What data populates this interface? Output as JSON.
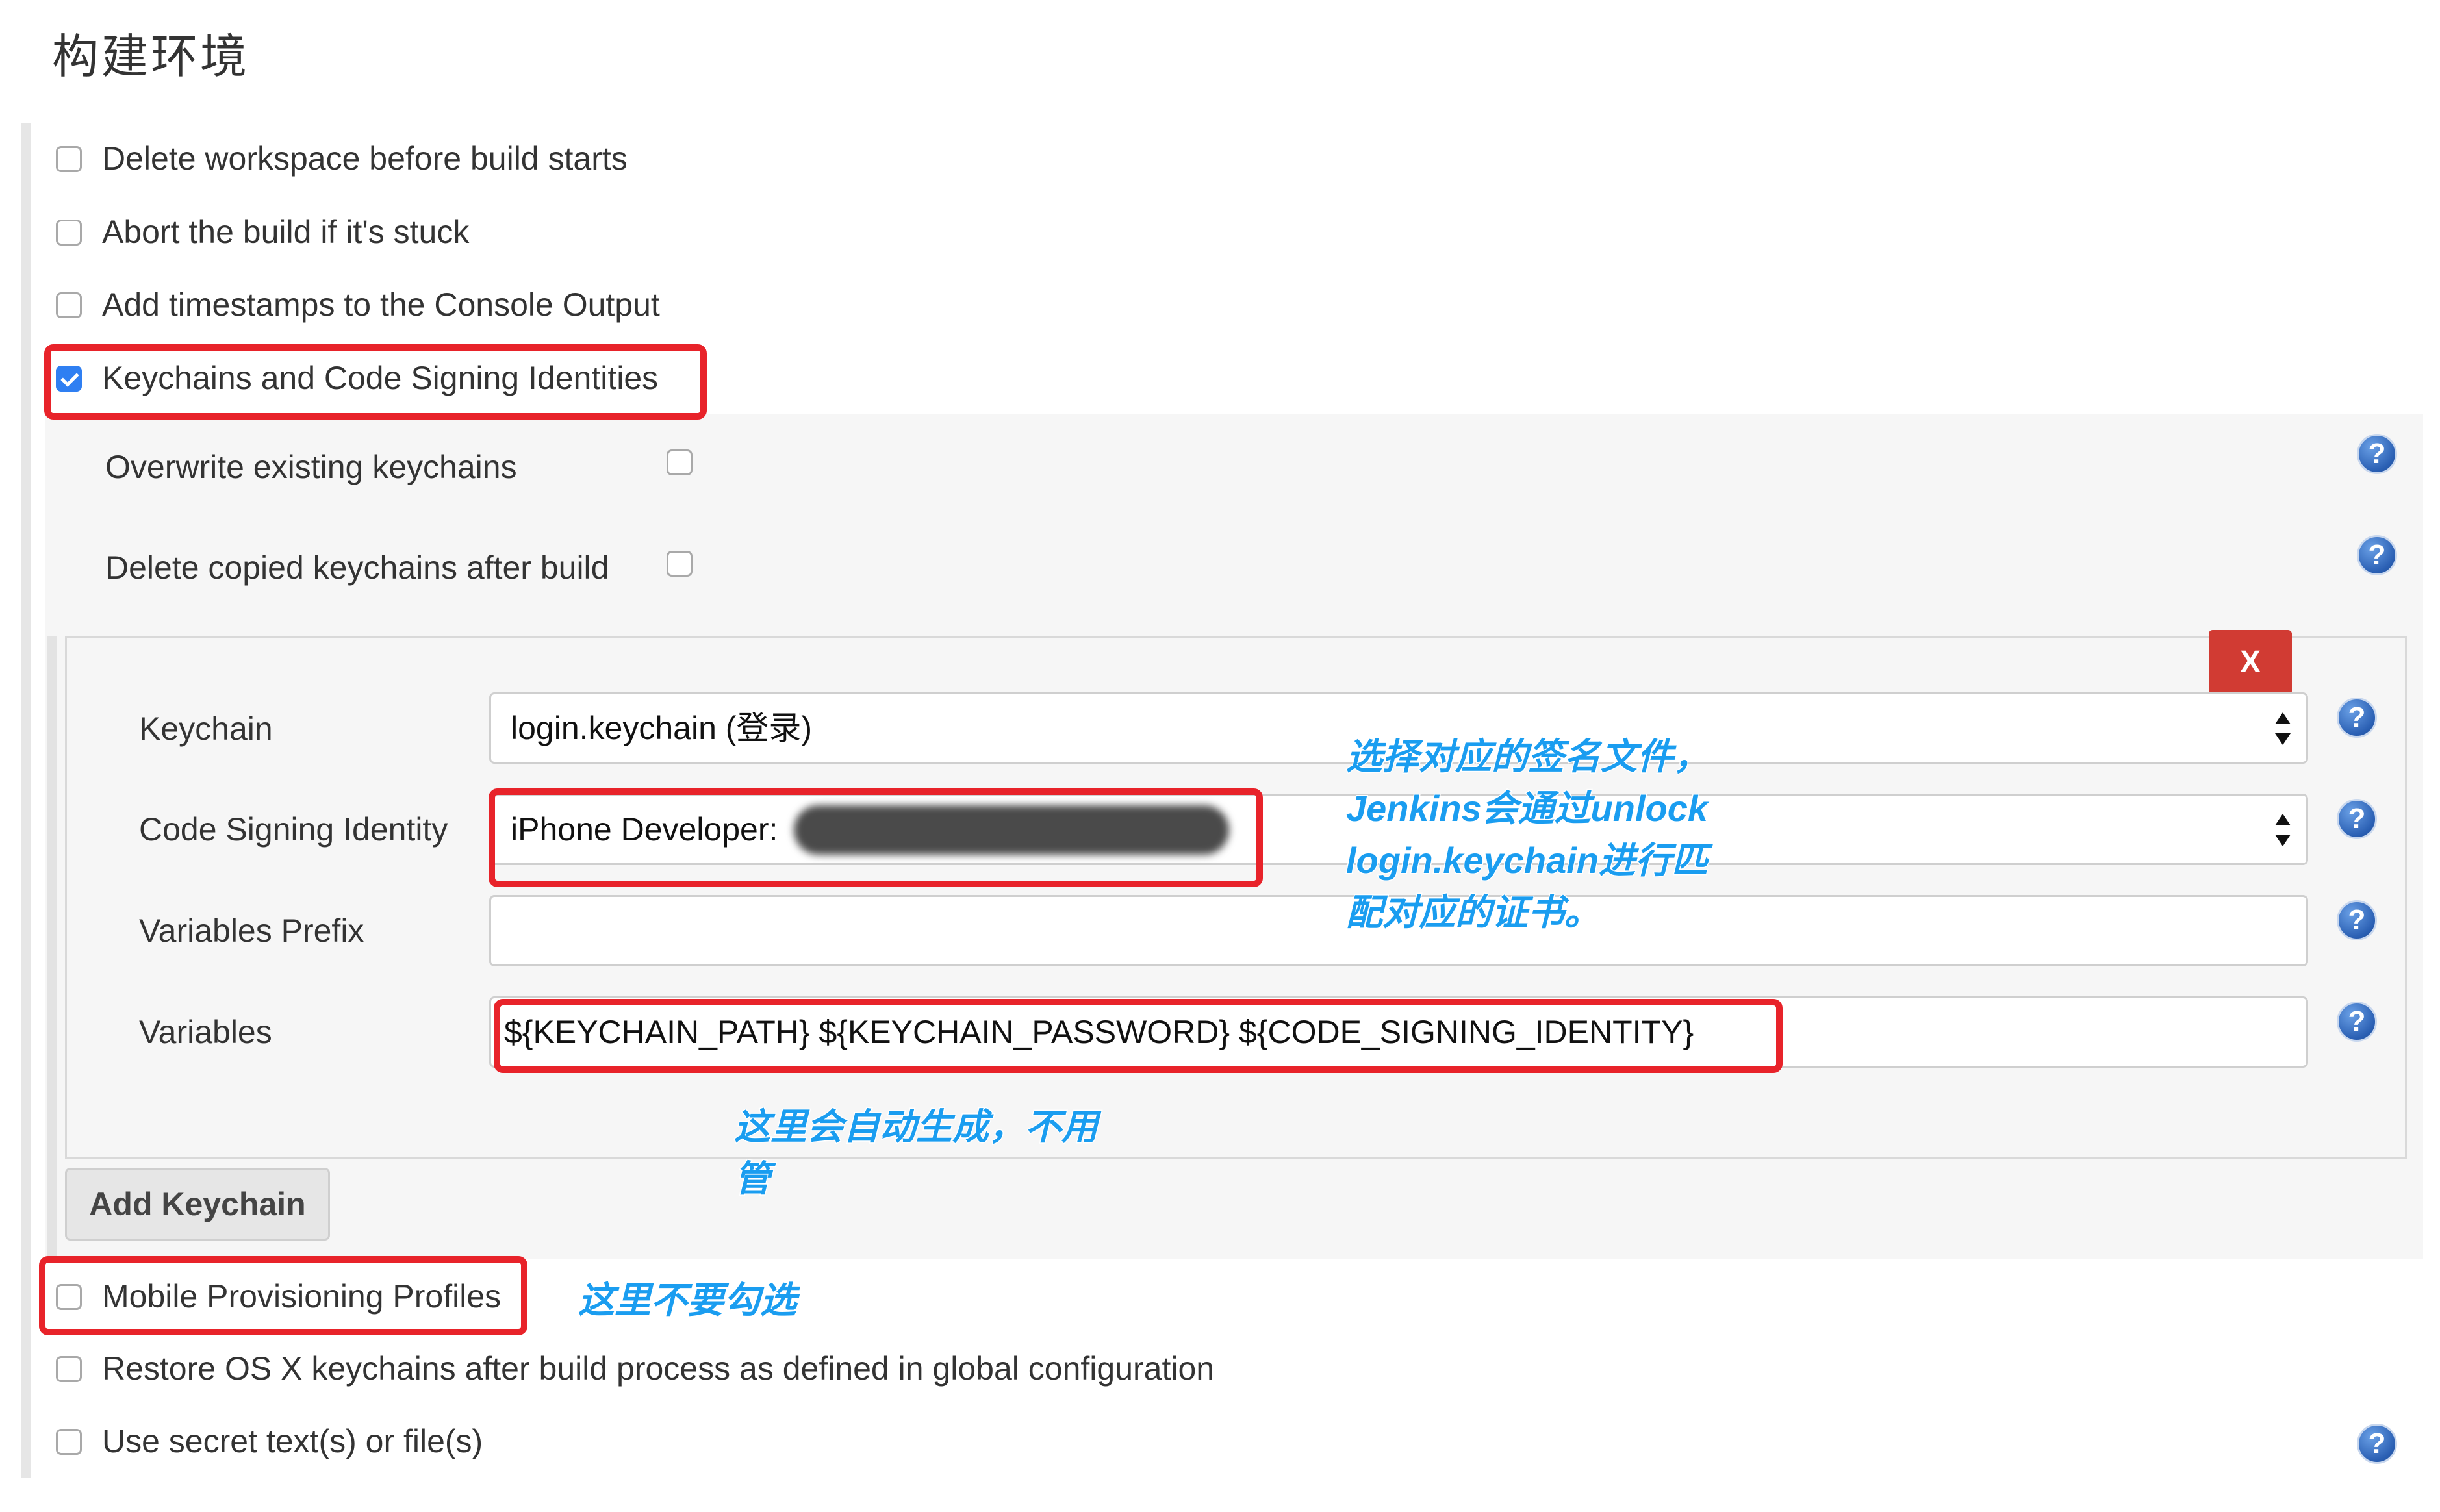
{
  "section_title": "构建环境",
  "options": [
    {
      "label": "Delete workspace before build starts",
      "checked": false
    },
    {
      "label": "Abort the build if it's stuck",
      "checked": false
    },
    {
      "label": "Add timestamps to the Console Output",
      "checked": false
    },
    {
      "label": "Keychains and Code Signing Identities",
      "checked": true
    }
  ],
  "keychain_settings": {
    "overwrite_label": "Overwrite existing keychains",
    "overwrite_checked": false,
    "delete_copied_label": "Delete copied keychains after build",
    "delete_copied_checked": false
  },
  "keychain_entry": {
    "delete_label": "X",
    "keychain_label": "Keychain",
    "keychain_value": "login.keychain (登录)",
    "identity_label": "Code Signing Identity",
    "identity_value": "iPhone Developer:",
    "prefix_label": "Variables Prefix",
    "prefix_value": "",
    "variables_label": "Variables",
    "variables_value": "${KEYCHAIN_PATH} ${KEYCHAIN_PASSWORD} ${CODE_SIGNING_IDENTITY}"
  },
  "add_keychain_label": "Add Keychain",
  "bottom_options": [
    {
      "label": "Mobile Provisioning Profiles",
      "checked": false
    },
    {
      "label": "Restore OS X keychains after build process as defined in global configuration",
      "checked": false
    },
    {
      "label": "Use secret text(s) or file(s)",
      "checked": false
    }
  ],
  "annotations": {
    "identity_note": [
      "选择对应的签名文件，",
      "Jenkins会通过unlock",
      "login.keychain进行匹",
      "配对应的证书。"
    ],
    "variables_note": [
      "这里会自动生成，不用",
      "管"
    ],
    "profiles_note": "这里不要勾选"
  },
  "help_icon_glyph": "?",
  "colors": {
    "highlight_red": "#e8232a",
    "annotation_blue": "#1a9df0",
    "checkbox_blue": "#2f7ff2",
    "delete_button": "#d13b33"
  }
}
